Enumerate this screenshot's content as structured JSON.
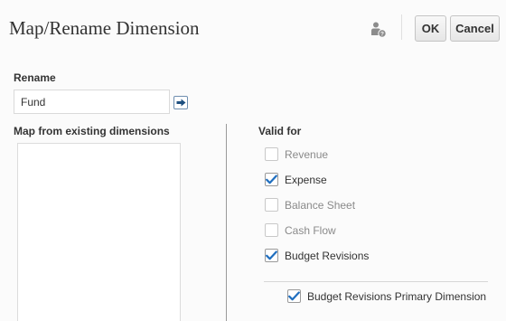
{
  "header": {
    "title": "Map/Rename Dimension",
    "help_icon": "person-help-icon",
    "ok_label": "OK",
    "cancel_label": "Cancel"
  },
  "rename": {
    "label": "Rename",
    "value": "Fund",
    "go_icon": "arrow-right-icon"
  },
  "map": {
    "label": "Map from existing dimensions",
    "items": []
  },
  "valid_for": {
    "label": "Valid for",
    "options": [
      {
        "label": "Revenue",
        "checked": false,
        "enabled": false
      },
      {
        "label": "Expense",
        "checked": true,
        "enabled": true
      },
      {
        "label": "Balance Sheet",
        "checked": false,
        "enabled": false
      },
      {
        "label": "Cash Flow",
        "checked": false,
        "enabled": false
      },
      {
        "label": "Budget Revisions",
        "checked": true,
        "enabled": true
      }
    ],
    "sub_option": {
      "label": "Budget Revisions Primary Dimension",
      "checked": true,
      "enabled": true
    }
  },
  "colors": {
    "check": "#1f6ebf",
    "disabled_text": "#8a8a8a",
    "text": "#333333"
  }
}
